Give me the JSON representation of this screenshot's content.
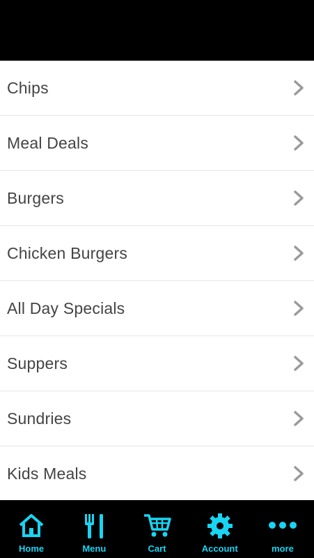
{
  "menu_items": [
    {
      "label": "Chips"
    },
    {
      "label": "Meal Deals"
    },
    {
      "label": "Burgers"
    },
    {
      "label": "Chicken Burgers"
    },
    {
      "label": "All Day Specials"
    },
    {
      "label": "Suppers"
    },
    {
      "label": "Sundries"
    },
    {
      "label": "Kids Meals"
    }
  ],
  "tabs": [
    {
      "label": "Home",
      "icon": "home-icon"
    },
    {
      "label": "Menu",
      "icon": "fork-knife-icon"
    },
    {
      "label": "Cart",
      "icon": "cart-icon"
    },
    {
      "label": "Account",
      "icon": "gear-icon"
    },
    {
      "label": "more",
      "icon": "more-dots-icon"
    }
  ],
  "colors": {
    "accent": "#19d4f2",
    "header": "#000000",
    "chevron": "#9a9a9a",
    "text": "#444444"
  }
}
